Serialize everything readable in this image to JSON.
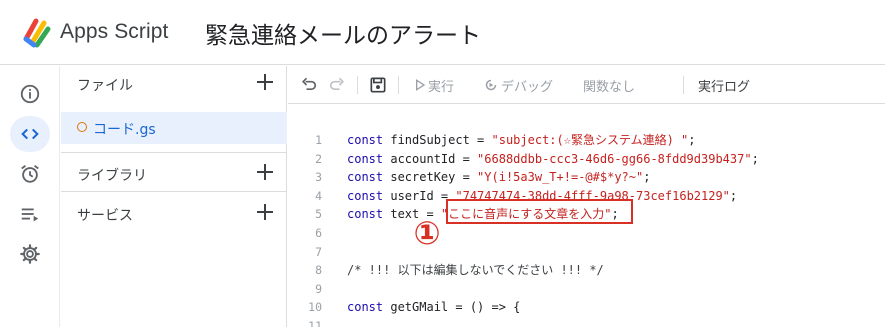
{
  "header": {
    "app_name": "Apps Script",
    "project_title": "緊急連絡メールのアラート"
  },
  "rail": {
    "items": [
      {
        "icon": "info-icon",
        "active": false
      },
      {
        "icon": "code-icon",
        "active": true
      },
      {
        "icon": "alarm-clock-icon",
        "active": false
      },
      {
        "icon": "executions-list-icon",
        "active": false
      },
      {
        "icon": "gear-icon",
        "active": false
      }
    ]
  },
  "files_panel": {
    "files_label": "ファイル",
    "file_name": "コード.gs",
    "libraries_label": "ライブラリ",
    "services_label": "サービス"
  },
  "toolbar": {
    "run_label": "実行",
    "debug_label": "デバッグ",
    "function_label": "関数なし",
    "log_label": "実行ログ"
  },
  "editor": {
    "lines": [
      {
        "n": "1",
        "kw": "const",
        "rest": " findSubject = ",
        "str": "\"subject:(☆緊急システム連絡) \"",
        "tail": ";"
      },
      {
        "n": "2",
        "kw": "const",
        "rest": " accountId = ",
        "str": "\"6688ddbb-ccc3-46d6-gg66-8fdd9d39b437\"",
        "tail": ";"
      },
      {
        "n": "3",
        "kw": "const",
        "rest": " secretKey = ",
        "str": "\"Y(i!5a3w_T+!=-@#$*y?~\"",
        "tail": ";"
      },
      {
        "n": "4",
        "kw": "const",
        "rest": " userId = ",
        "str": "\"74747474-38dd-4fff-9a98-73cef16b2129\"",
        "tail": ";"
      },
      {
        "n": "5",
        "kw": "const",
        "rest": " text = ",
        "str": "\"ここに音声にする文章を入力\"",
        "tail": ";"
      },
      {
        "n": "6",
        "kw": "",
        "rest": "",
        "str": "",
        "tail": ""
      },
      {
        "n": "7",
        "kw": "",
        "rest": "",
        "str": "",
        "tail": ""
      },
      {
        "n": "8",
        "kw": "",
        "rest": "/* !!! 以下は編集しないでください !!! */",
        "str": "",
        "tail": ""
      },
      {
        "n": "9",
        "kw": "",
        "rest": "",
        "str": "",
        "tail": ""
      },
      {
        "n": "10",
        "kw": "const",
        "rest": " getGMail = () => {",
        "str": "",
        "tail": ""
      },
      {
        "n": "11",
        "kw": "",
        "rest": "",
        "str": "",
        "tail": ""
      }
    ]
  },
  "annotation": {
    "marker": "①"
  },
  "colors": {
    "accent": "#1967d2",
    "active_bg": "#e8f0fe",
    "string": "#c5221f",
    "keyword": "#1a0dab",
    "annotation": "#d93025"
  }
}
